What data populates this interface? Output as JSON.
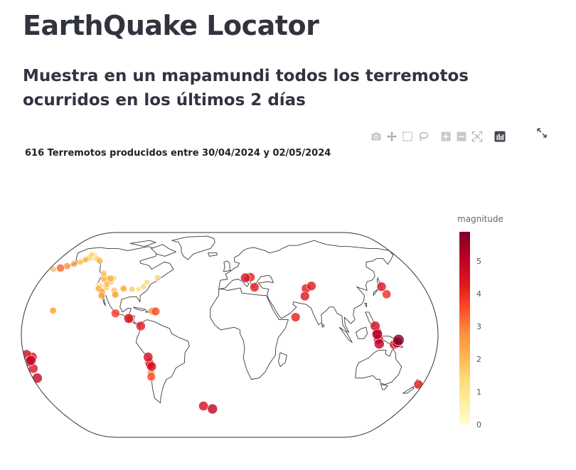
{
  "page": {
    "title": "EarthQuake Locator",
    "subtitle": "Muestra en un mapamundi todos los terremotos ocurridos en los últimos 2 días"
  },
  "plot": {
    "title": "616 Terremotos producidos entre 30/04/2024 y 02/05/2024"
  },
  "modebar": {
    "buttons": [
      "camera-icon",
      "pan-icon",
      "box-select-icon",
      "lasso-icon",
      "zoom-in-icon",
      "zoom-out-icon",
      "autoscale-icon",
      "plotly-logo-icon"
    ],
    "fullscreen": "expand-icon"
  },
  "colorbar": {
    "title": "magnitude",
    "ticks": [
      "0",
      "1",
      "2",
      "3",
      "4",
      "5"
    ],
    "range": [
      0,
      5.9
    ]
  },
  "colors": {
    "text": "#31333f",
    "scale_low": "#ffffcc",
    "scale_high": "#800026"
  },
  "map_data": {
    "projection": "natural-earth",
    "earthquakes": [
      {
        "lon": -150.5,
        "lat": 61.5,
        "mag": 1.6
      },
      {
        "lon": -149.0,
        "lat": 63.0,
        "mag": 1.4
      },
      {
        "lon": -152.0,
        "lat": 60.0,
        "mag": 2.0
      },
      {
        "lon": -147.0,
        "lat": 61.0,
        "mag": 1.2
      },
      {
        "lon": -155.0,
        "lat": 58.0,
        "mag": 1.8
      },
      {
        "lon": -160.0,
        "lat": 56.5,
        "mag": 2.4
      },
      {
        "lon": -165.0,
        "lat": 54.5,
        "mag": 2.6
      },
      {
        "lon": -170.0,
        "lat": 53.0,
        "mag": 3.3
      },
      {
        "lon": -176.0,
        "lat": 52.0,
        "mag": 1.9
      },
      {
        "lon": -144.0,
        "lat": 62.0,
        "mag": 1.3
      },
      {
        "lon": -146.0,
        "lat": 64.0,
        "mag": 1.1
      },
      {
        "lon": -151.0,
        "lat": 64.5,
        "mag": 1.5
      },
      {
        "lon": -140.0,
        "lat": 60.5,
        "mag": 1.7
      },
      {
        "lon": -136.0,
        "lat": 59.0,
        "mag": 2.1
      },
      {
        "lon": -123.0,
        "lat": 48.5,
        "mag": 1.9
      },
      {
        "lon": -122.5,
        "lat": 47.0,
        "mag": 1.5
      },
      {
        "lon": -120.0,
        "lat": 44.0,
        "mag": 2.0
      },
      {
        "lon": -119.0,
        "lat": 43.0,
        "mag": 1.6
      },
      {
        "lon": -117.0,
        "lat": 44.5,
        "mag": 1.8
      },
      {
        "lon": -114.0,
        "lat": 44.5,
        "mag": 2.3
      },
      {
        "lon": -111.0,
        "lat": 44.7,
        "mag": 1.4
      },
      {
        "lon": -112.0,
        "lat": 41.5,
        "mag": 1.7
      },
      {
        "lon": -115.0,
        "lat": 40.0,
        "mag": 2.0
      },
      {
        "lon": -117.5,
        "lat": 38.0,
        "mag": 1.3
      },
      {
        "lon": -118.5,
        "lat": 37.5,
        "mag": 1.1
      },
      {
        "lon": -120.5,
        "lat": 38.5,
        "mag": 1.4
      },
      {
        "lon": -122.0,
        "lat": 37.5,
        "mag": 1.6
      },
      {
        "lon": -121.0,
        "lat": 36.5,
        "mag": 2.2
      },
      {
        "lon": -122.8,
        "lat": 38.8,
        "mag": 1.2
      },
      {
        "lon": -119.0,
        "lat": 35.5,
        "mag": 1.8
      },
      {
        "lon": -117.0,
        "lat": 34.0,
        "mag": 2.4
      },
      {
        "lon": -116.5,
        "lat": 33.5,
        "mag": 1.5
      },
      {
        "lon": -118.0,
        "lat": 34.5,
        "mag": 1.1
      },
      {
        "lon": -115.5,
        "lat": 32.7,
        "mag": 2.0
      },
      {
        "lon": -116.0,
        "lat": 31.0,
        "mag": 2.5
      },
      {
        "lon": -114.0,
        "lat": 37.0,
        "mag": 1.6
      },
      {
        "lon": -106.0,
        "lat": 35.0,
        "mag": 1.9
      },
      {
        "lon": -104.0,
        "lat": 31.8,
        "mag": 2.4
      },
      {
        "lon": -103.0,
        "lat": 31.5,
        "mag": 2.1
      },
      {
        "lon": -98.0,
        "lat": 36.5,
        "mag": 2.2
      },
      {
        "lon": -97.5,
        "lat": 36.0,
        "mag": 1.8
      },
      {
        "lon": -90.0,
        "lat": 36.0,
        "mag": 1.7
      },
      {
        "lon": -84.0,
        "lat": 36.0,
        "mag": 1.3
      },
      {
        "lon": -80.0,
        "lat": 38.0,
        "mag": 1.5
      },
      {
        "lon": -78.0,
        "lat": 41.5,
        "mag": 1.4
      },
      {
        "lon": -69.0,
        "lat": 45.0,
        "mag": 1.6
      },
      {
        "lon": -155.5,
        "lat": 19.4,
        "mag": 1.9
      },
      {
        "lon": -155.3,
        "lat": 19.2,
        "mag": 2.3
      },
      {
        "lon": -100.0,
        "lat": 17.0,
        "mag": 3.8
      },
      {
        "lon": -88.0,
        "lat": 13.0,
        "mag": 4.6
      },
      {
        "lon": -86.5,
        "lat": 12.5,
        "mag": 3.4
      },
      {
        "lon": -68.0,
        "lat": 18.8,
        "mag": 2.8
      },
      {
        "lon": -66.5,
        "lat": 18.0,
        "mag": 2.2
      },
      {
        "lon": -65.0,
        "lat": 18.5,
        "mag": 3.6
      },
      {
        "lon": -67.0,
        "lat": 19.3,
        "mag": 2.6
      },
      {
        "lon": -77.0,
        "lat": 7.0,
        "mag": 4.3
      },
      {
        "lon": -71.5,
        "lat": -17.5,
        "mag": 4.6
      },
      {
        "lon": -71.0,
        "lat": -22.0,
        "mag": 4.2
      },
      {
        "lon": -70.5,
        "lat": -23.5,
        "mag": 4.4
      },
      {
        "lon": -69.5,
        "lat": -25.0,
        "mag": 4.5
      },
      {
        "lon": -71.0,
        "lat": -30.0,
        "mag": 2.9
      },
      {
        "lon": -71.5,
        "lat": -33.0,
        "mag": 3.6
      },
      {
        "lon": -27.0,
        "lat": -56.5,
        "mag": 4.6
      },
      {
        "lon": -18.0,
        "lat": -59.0,
        "mag": 5.0
      },
      {
        "lon": -177.5,
        "lat": -15.5,
        "mag": 4.7
      },
      {
        "lon": -173.0,
        "lat": -17.5,
        "mag": 4.6
      },
      {
        "lon": -175.0,
        "lat": -20.0,
        "mag": 5.0
      },
      {
        "lon": -177.0,
        "lat": -21.0,
        "mag": 4.8
      },
      {
        "lon": -175.5,
        "lat": -26.5,
        "mag": 4.5
      },
      {
        "lon": -176.0,
        "lat": -34.0,
        "mag": 4.9
      },
      {
        "lon": 15.0,
        "lat": 45.0,
        "mag": 4.6
      },
      {
        "lon": 20.0,
        "lat": 45.5,
        "mag": 4.2
      },
      {
        "lon": 23.0,
        "lat": 37.5,
        "mag": 4.3
      },
      {
        "lon": 57.5,
        "lat": 14.0,
        "mag": 4.2
      },
      {
        "lon": 70.5,
        "lat": 36.5,
        "mag": 4.3
      },
      {
        "lon": 76.0,
        "lat": 38.5,
        "mag": 4.3
      },
      {
        "lon": 68.0,
        "lat": 30.5,
        "mag": 4.4
      },
      {
        "lon": 142.5,
        "lat": 32.0,
        "mag": 4.0
      },
      {
        "lon": 141.0,
        "lat": 38.0,
        "mag": 4.4
      },
      {
        "lon": 126.0,
        "lat": 7.0,
        "mag": 4.7
      },
      {
        "lon": 127.5,
        "lat": 2.0,
        "mag": 4.6
      },
      {
        "lon": 127.5,
        "lat": 0.5,
        "mag": 5.2
      },
      {
        "lon": 128.5,
        "lat": -3.5,
        "mag": 4.8
      },
      {
        "lon": 129.5,
        "lat": -7.0,
        "mag": 5.1
      },
      {
        "lon": 146.0,
        "lat": -4.0,
        "mag": 5.9
      },
      {
        "lon": 145.0,
        "lat": -6.0,
        "mag": 5.3
      },
      {
        "lon": 142.5,
        "lat": -7.5,
        "mag": 4.6
      },
      {
        "lon": 176.0,
        "lat": -39.0,
        "mag": 4.2
      }
    ]
  }
}
